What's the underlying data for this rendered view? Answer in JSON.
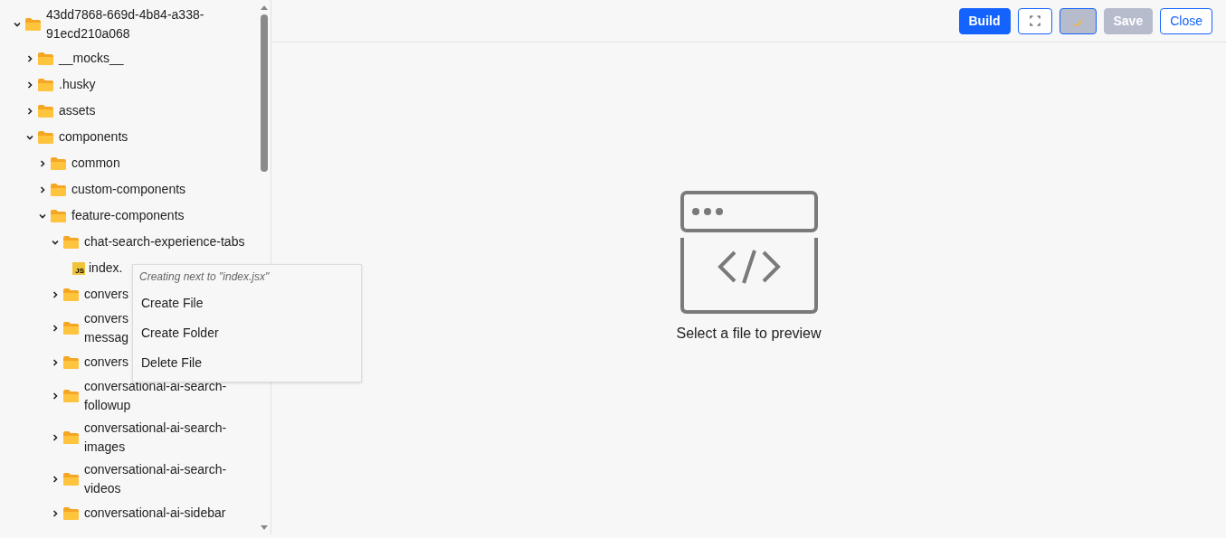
{
  "tree": [
    {
      "kind": "folder",
      "label": "43dd7868-669d-4b84-a338-\n91ecd210a068",
      "expanded": true,
      "children": [
        {
          "kind": "folder",
          "label": "__mocks__",
          "expanded": false
        },
        {
          "kind": "folder",
          "label": ".husky",
          "expanded": false
        },
        {
          "kind": "folder",
          "label": "assets",
          "expanded": false
        },
        {
          "kind": "folder",
          "label": "components",
          "expanded": true,
          "children": [
            {
              "kind": "folder",
              "label": "common",
              "expanded": false
            },
            {
              "kind": "folder",
              "label": "custom-components",
              "expanded": false
            },
            {
              "kind": "folder",
              "label": "feature-components",
              "expanded": true,
              "children": [
                {
                  "kind": "folder",
                  "label": "chat-search-experience-tabs",
                  "expanded": true,
                  "children": [
                    {
                      "kind": "file",
                      "label": "index.",
                      "badge": "JS"
                    }
                  ]
                },
                {
                  "kind": "folder",
                  "label": "convers",
                  "expanded": false
                },
                {
                  "kind": "folder",
                  "label": "convers\nmessag",
                  "expanded": false
                },
                {
                  "kind": "folder",
                  "label": "convers",
                  "expanded": false
                },
                {
                  "kind": "folder",
                  "label": "conversational-ai-search-\nfollowup",
                  "expanded": false
                },
                {
                  "kind": "folder",
                  "label": "conversational-ai-search-\nimages",
                  "expanded": false
                },
                {
                  "kind": "folder",
                  "label": "conversational-ai-search-\nvideos",
                  "expanded": false
                },
                {
                  "kind": "folder",
                  "label": "conversational-ai-sidebar",
                  "expanded": false
                }
              ]
            }
          ]
        }
      ]
    }
  ],
  "context_menu": {
    "caption": "Creating next to \"index.jsx\"",
    "items": [
      "Create File",
      "Create Folder",
      "Delete File"
    ]
  },
  "toolbar": [
    {
      "kind": "primary",
      "label": "Build"
    },
    {
      "kind": "fullscreen"
    },
    {
      "kind": "theme"
    },
    {
      "kind": "disabled",
      "label": "Save"
    },
    {
      "kind": "outline",
      "label": "Close"
    }
  ],
  "preview": {
    "message": "Select a file to preview"
  }
}
